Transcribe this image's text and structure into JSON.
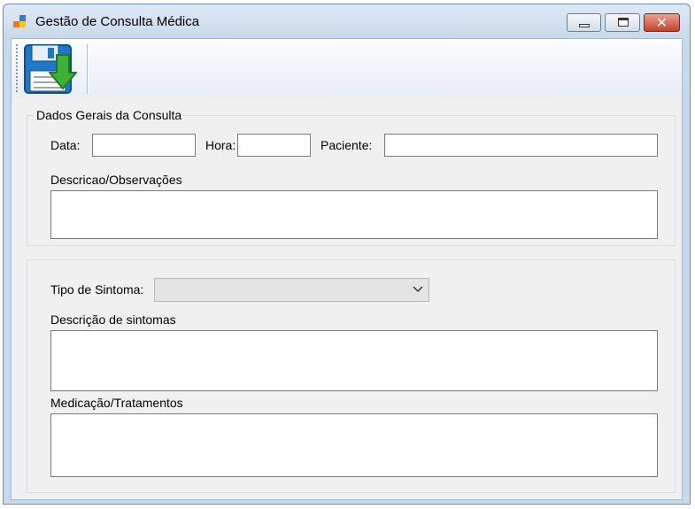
{
  "window": {
    "title": "Gestão de Consulta Médica",
    "close_symbol": "✕",
    "app_icon": "windows-form-icon"
  },
  "toolbar": {
    "save_icon": "floppy-save-icon",
    "save_tooltip": ""
  },
  "group_general": {
    "legend": "Dados Gerais da Consulta",
    "date_label": "Data:",
    "date_value": "",
    "time_label": "Hora:",
    "time_value": "",
    "patient_label": "Paciente:",
    "patient_value": "",
    "notes_label": "Descricao/Observações",
    "notes_value": ""
  },
  "group_symptoms": {
    "legend": "",
    "symptom_type_label": "Tipo de Sintoma:",
    "symptom_type_value": "",
    "symptoms_desc_label": "Descrição de sintomas",
    "symptoms_desc_value": "",
    "medication_label": "Medicação/Tratamentos",
    "medication_value": ""
  },
  "colors": {
    "title_bar": "#c9d9ec",
    "close_button": "#c5412b",
    "form_background": "#f0f0f0",
    "save_icon_blue": "#1e78c8",
    "save_icon_green": "#3fb03a"
  }
}
